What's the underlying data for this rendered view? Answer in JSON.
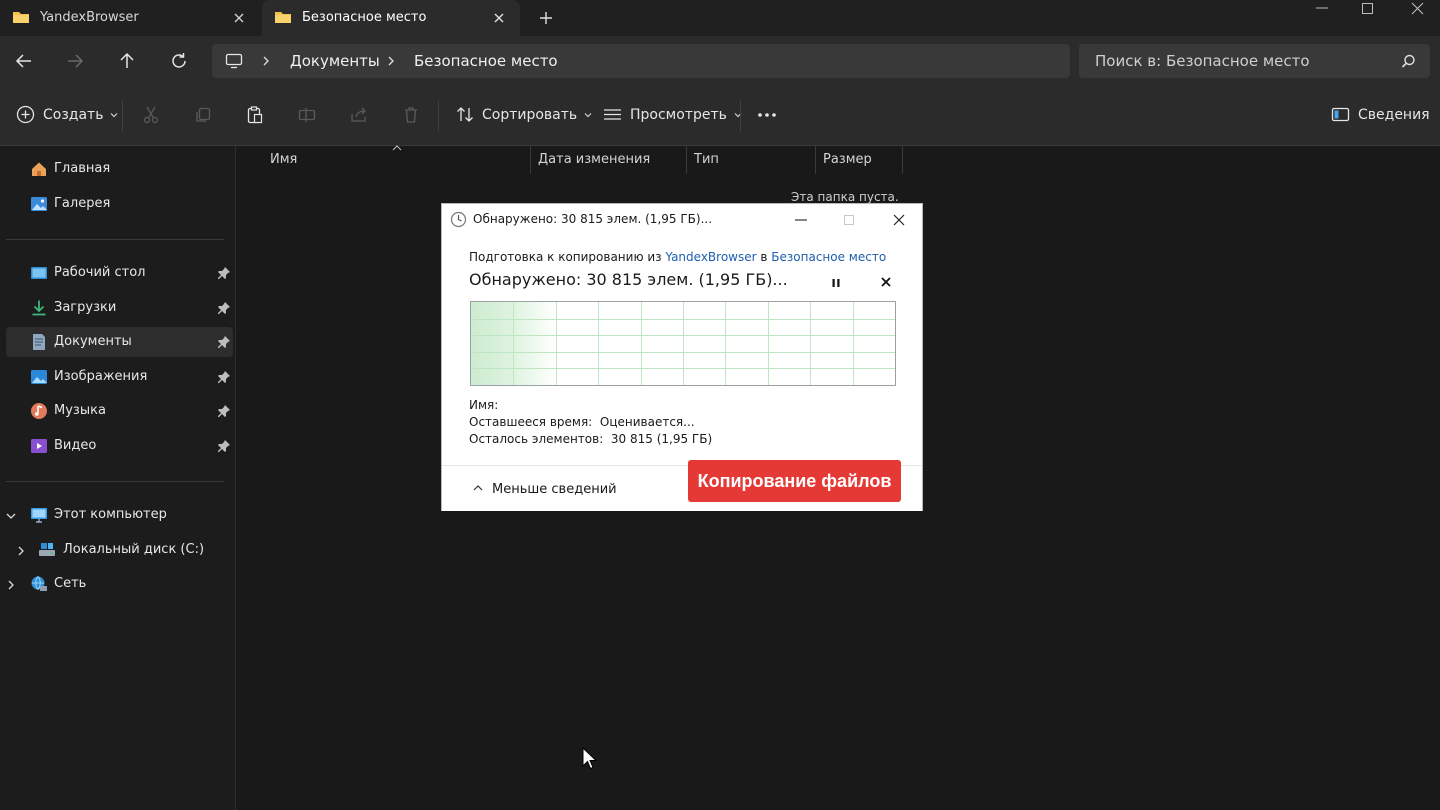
{
  "tabs": [
    {
      "label": "YandexBrowser",
      "active": false
    },
    {
      "label": "Безопасное место",
      "active": true
    }
  ],
  "breadcrumb": [
    {
      "label": "Документы"
    },
    {
      "label": "Безопасное место"
    }
  ],
  "search": {
    "placeholder": "Поиск в: Безопасное место"
  },
  "toolbar": {
    "create_label": "Создать",
    "sort_label": "Сортировать",
    "view_label": "Просмотреть",
    "more_label": "...",
    "details_label": "Сведения"
  },
  "sidebar": {
    "items": [
      {
        "label": "Главная",
        "icon": "home-icon"
      },
      {
        "label": "Галерея",
        "icon": "gallery-icon"
      },
      {
        "label": "Рабочий стол",
        "icon": "desktop-icon",
        "pinned": true
      },
      {
        "label": "Загрузки",
        "icon": "downloads-icon",
        "pinned": true
      },
      {
        "label": "Документы",
        "icon": "documents-icon",
        "pinned": true,
        "active": true
      },
      {
        "label": "Изображения",
        "icon": "pictures-icon",
        "pinned": true
      },
      {
        "label": "Музыка",
        "icon": "music-icon",
        "pinned": true
      },
      {
        "label": "Видео",
        "icon": "video-icon",
        "pinned": true
      },
      {
        "label": "Этот компьютер",
        "icon": "this-pc-icon",
        "expanded": true
      },
      {
        "label": "Локальный диск (C:)",
        "icon": "drive-icon"
      },
      {
        "label": "Сеть",
        "icon": "network-icon"
      }
    ]
  },
  "columns": [
    "Имя",
    "Дата изменения",
    "Тип",
    "Размер"
  ],
  "empty_message": "Эта папка пуста.",
  "dialog": {
    "title": "Обнаружено: 30 815 элем. (1,95 ГБ)...",
    "prep_prefix": "Подготовка к копированию из",
    "source": "YandexBrowser",
    "prep_mid": "в",
    "destination": "Безопасное место",
    "status": "Обнаружено: 30 815 элем. (1,95 ГБ)...",
    "name_label": "Имя:",
    "time_label": "Оставшееся время:",
    "time_value": "Оценивается...",
    "items_label": "Осталось элементов:",
    "items_value": "30 815 (1,95 ГБ)",
    "less_details": "Меньше сведений",
    "progress": 0.0
  },
  "overlay_label": "Копирование файлов",
  "colors": {
    "accent_green": "#d4f3d8",
    "badge_red": "#e53935",
    "link_blue": "#1f5fb0",
    "arrow_red": "#e53935"
  }
}
